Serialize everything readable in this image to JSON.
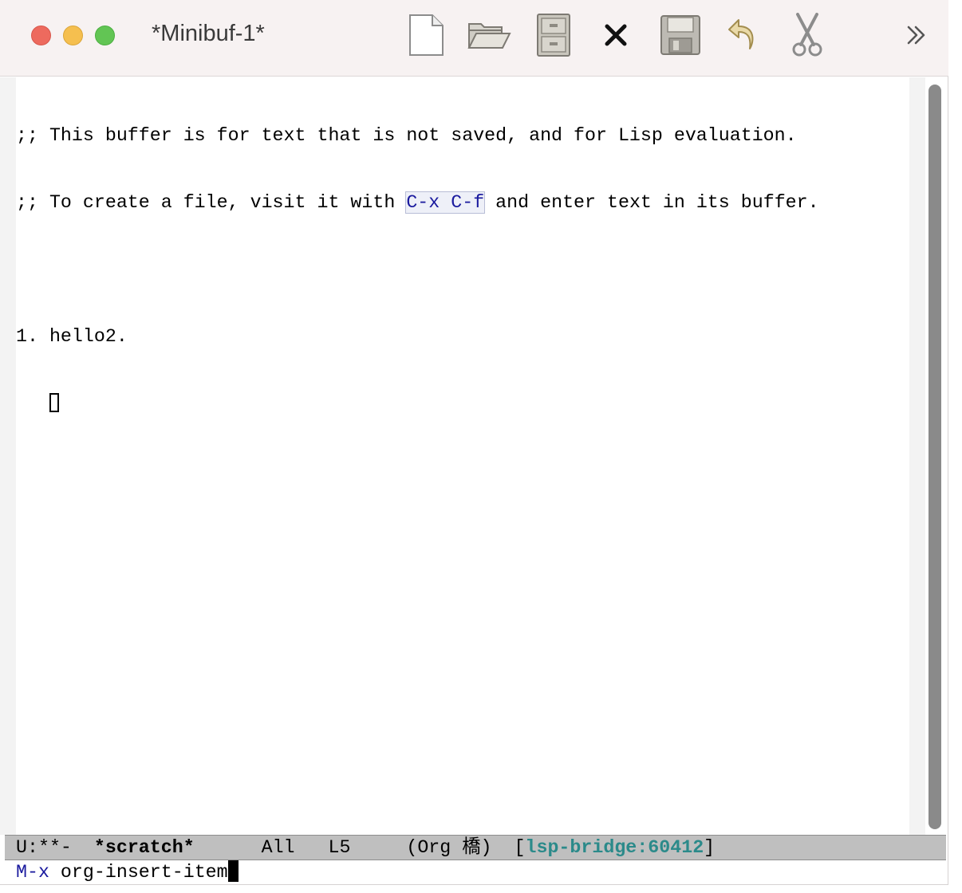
{
  "window": {
    "title": "*Minibuf-1*"
  },
  "toolbar": {
    "items": [
      {
        "name": "new-file",
        "icon": "blank-document-icon"
      },
      {
        "name": "open-file",
        "icon": "open-folder-icon"
      },
      {
        "name": "dired",
        "icon": "file-cabinet-icon"
      },
      {
        "name": "kill-buffer",
        "icon": "close-x-icon"
      },
      {
        "name": "save",
        "icon": "floppy-disk-icon"
      },
      {
        "name": "undo",
        "icon": "undo-arrow-icon"
      },
      {
        "name": "cut",
        "icon": "scissors-icon"
      }
    ],
    "more_icon": "double-chevron-right-icon"
  },
  "buffer": {
    "line1": ";; This buffer is for text that is not saved, and for Lisp evaluation.",
    "line2_prefix": ";; To create a file, visit it with ",
    "line2_key": "C-x C-f",
    "line2_suffix": " and enter text in its buffer.",
    "line4": "1. hello2.",
    "line5_indent": "   "
  },
  "modeline": {
    "status": "U:**-  ",
    "buffer_name": "*scratch*",
    "position": "      All   L5     ",
    "mode": "(Org 橋)",
    "lsp_open": "  [",
    "lsp": "lsp-bridge:60412",
    "lsp_close": "]"
  },
  "minibuffer": {
    "prompt": "M-x",
    "input": " org-insert-item"
  },
  "colors": {
    "titlebar": "#f7f2f2",
    "modeline": "#bfbfbf",
    "keybinding": "#1a1a9e",
    "lsp": "#2b8a8a",
    "scrollbar": "#8a8a8a"
  }
}
